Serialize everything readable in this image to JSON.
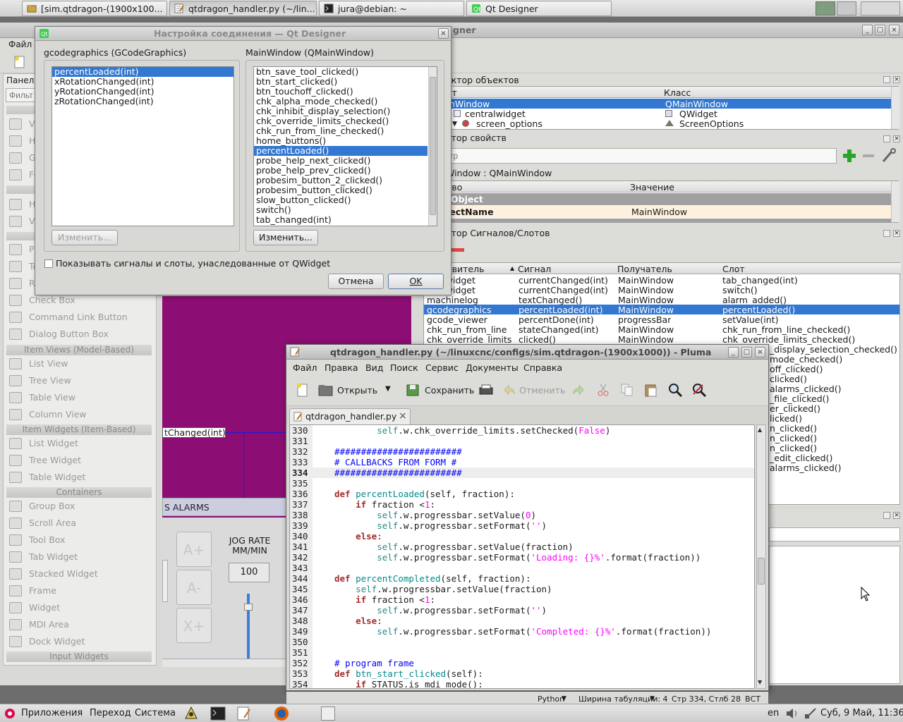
{
  "taskbar_top": {
    "tasks": [
      {
        "label": "[sim.qtdragon-(1900x100...",
        "icon": "folder-icon"
      },
      {
        "label": "qtdragon_handler.py (~/lin...",
        "icon": "text-editor-icon"
      },
      {
        "label": "jura@debian: ~",
        "icon": "terminal-icon"
      },
      {
        "label": "Qt Designer",
        "icon": "qt-icon"
      }
    ]
  },
  "designer": {
    "title_fragment": "gner",
    "menu_file": "Файл",
    "panel_label": "Панел",
    "filter_placeholder": "Фильт",
    "widget_box": {
      "items_top": [
        "Ve",
        "Ho",
        "Gr",
        "Fo",
        "Ho",
        "Ve",
        "Pu",
        "To",
        "Ra"
      ],
      "categories": {
        "item_views": "Item Views (Model-Based)",
        "item_widgets": "Item Widgets (Item-Based)",
        "containers": "Containers",
        "input_widgets": "Input Widgets"
      },
      "buttons": [
        "Check Box",
        "Command Link Button",
        "Dialog Button Box"
      ],
      "views": [
        "List View",
        "Tree View",
        "Table View",
        "Column View"
      ],
      "item_widgets": [
        "List Widget",
        "Tree Widget",
        "Table Widget"
      ],
      "containers": [
        "Group Box",
        "Scroll Area",
        "Tool Box",
        "Tab Widget",
        "Stacked Widget",
        "Frame",
        "Widget",
        "MDI Area",
        "Dock Widget"
      ]
    },
    "form": {
      "connection_label": "tChanged(int)",
      "alarms_tab": "S ALARMS",
      "jog_rate_label": "JOG RATE\nMM/MIN",
      "jog_rate_value": "100",
      "jog_btn_plus": "A+",
      "jog_btn_minus": "A-",
      "jog_btn_x": "X+"
    },
    "object_inspector": {
      "title": "ектор объектов",
      "col_object": "кт",
      "col_class": "Класс",
      "rows": [
        {
          "object": "nWindow",
          "class": "QMainWindow",
          "selected": true
        },
        {
          "object": "centralwidget",
          "class": "QWidget",
          "selected": false
        },
        {
          "object": "screen_options",
          "class": "ScreenOptions",
          "selected": false
        }
      ]
    },
    "property_editor": {
      "title": "ктор свойств",
      "filter_placeholder": "тр",
      "context": "Window : QMainWindow",
      "col_property": "тво",
      "col_value": "Значение",
      "section": "Object",
      "prop_name": "jectName",
      "prop_value": "MainWindow"
    },
    "signal_slot_editor": {
      "title": "ктор Сигналов/Слотов",
      "col_sender": "авитель",
      "col_signal": "Сигнал",
      "col_receiver": "Получатель",
      "col_slot": "Слот",
      "rows": [
        {
          "sender": "tab_widget",
          "signal": "currentChanged(int)",
          "receiver": "MainWindow",
          "slot": "tab_changed(int)",
          "selected": false
        },
        {
          "sender": "tab_widget",
          "signal": "currentChanged(int)",
          "receiver": "MainWindow",
          "slot": "switch()",
          "selected": false
        },
        {
          "sender": "machinelog",
          "signal": "textChanged()",
          "receiver": "MainWindow",
          "slot": "alarm_added()",
          "selected": false
        },
        {
          "sender": "gcodegraphics",
          "signal": "percentLoaded(int)",
          "receiver": "MainWindow",
          "slot": "percentLoaded()",
          "selected": true
        },
        {
          "sender": "gcode_viewer",
          "signal": "percentDone(int)",
          "receiver": "progressBar",
          "slot": "setValue(int)",
          "selected": false
        },
        {
          "sender": "chk_run_from_line",
          "signal": "stateChanged(int)",
          "receiver": "MainWindow",
          "slot": "chk_run_from_line_checked()",
          "selected": false
        },
        {
          "sender": "chk_override_limits",
          "signal": "clicked()",
          "receiver": "MainWindow",
          "slot": "chk_override_limits_checked()",
          "selected": false
        }
      ],
      "more_slots": [
        "_display_selection_checked()",
        "mode_checked()",
        "off_clicked()",
        "clicked()",
        "alarms_clicked()",
        "_file_clicked()",
        "er_clicked()",
        "licked()",
        "n_clicked()",
        "n_clicked()",
        "n_clicked()",
        "_edit_clicked()",
        "alarms_clicked()"
      ]
    }
  },
  "conn_dialog": {
    "title": "Настройка соединения — Qt Designer",
    "left_group": "gcodegraphics (GCodeGraphics)",
    "right_group": "MainWindow (QMainWindow)",
    "signals": [
      "percentLoaded(int)",
      "xRotationChanged(int)",
      "yRotationChanged(int)",
      "zRotationChanged(int)"
    ],
    "signals_selected": 0,
    "slots": [
      "btn_save_tool_clicked()",
      "btn_start_clicked()",
      "btn_touchoff_clicked()",
      "chk_alpha_mode_checked()",
      "chk_inhibit_display_selection()",
      "chk_override_limits_checked()",
      "chk_run_from_line_checked()",
      "home_buttons()",
      "percentLoaded()",
      "probe_help_next_clicked()",
      "probe_help_prev_clicked()",
      "probesim_button_2_clicked()",
      "probesim_button_clicked()",
      "slow_button_clicked()",
      "switch()",
      "tab_changed(int)"
    ],
    "slots_selected": 8,
    "edit_left": "Изменить...",
    "edit_right": "Изменить...",
    "show_inherited": "Показывать сигналы и слоты, унаследованные от QWidget",
    "cancel": "Отмена",
    "ok": "OK"
  },
  "pluma": {
    "title": "qtdragon_handler.py (~/linuxcnc/configs/sim.qtdragon-(1900x1000)) - Pluma",
    "menu": [
      "Файл",
      "Правка",
      "Вид",
      "Поиск",
      "Сервис",
      "Документы",
      "Справка"
    ],
    "toolbar": {
      "open": "Открыть",
      "save": "Сохранить",
      "undo": "Отменить"
    },
    "tab_label": "qtdragon_handler.py",
    "current_line": 334,
    "lines": [
      {
        "n": "330",
        "html": "        <span class=\"slf\">self</span>.w.chk_override_limits.setChecked(<span class=\"cst\">False</span>)"
      },
      {
        "n": "331",
        "html": ""
      },
      {
        "n": "332",
        "html": "<span class=\"cm\">########################</span>"
      },
      {
        "n": "333",
        "html": "<span class=\"cm\"># CALLBACKS FROM FORM #</span>"
      },
      {
        "n": "334",
        "html": "<span class=\"cm\">########################</span>"
      },
      {
        "n": "335",
        "html": ""
      },
      {
        "n": "336",
        "html": "<span class=\"kw\">def</span> <span class=\"fn\">percentLoaded</span>(self, fraction):"
      },
      {
        "n": "337",
        "html": "    <span class=\"kw\">if</span> fraction &lt;<span class=\"num\">1</span>:"
      },
      {
        "n": "338",
        "html": "        <span class=\"slf\">self</span>.w.progressbar.setValue(<span class=\"num\">0</span>)"
      },
      {
        "n": "339",
        "html": "        <span class=\"slf\">self</span>.w.progressbar.setFormat(<span class=\"str\">''</span>)"
      },
      {
        "n": "340",
        "html": "    <span class=\"kw\">else</span>:"
      },
      {
        "n": "341",
        "html": "        <span class=\"slf\">self</span>.w.progressbar.setValue(fraction)"
      },
      {
        "n": "342",
        "html": "        <span class=\"slf\">self</span>.w.progressbar.setFormat(<span class=\"str\">'Loading: {}%'</span>.format(fraction))"
      },
      {
        "n": "343",
        "html": ""
      },
      {
        "n": "344",
        "html": "<span class=\"kw\">def</span> <span class=\"fn\">percentCompleted</span>(self, fraction):"
      },
      {
        "n": "345",
        "html": "    <span class=\"slf\">self</span>.w.progressbar.setValue(fraction)"
      },
      {
        "n": "346",
        "html": "    <span class=\"kw\">if</span> fraction &lt;<span class=\"num\">1</span>:"
      },
      {
        "n": "347",
        "html": "        <span class=\"slf\">self</span>.w.progressbar.setFormat(<span class=\"str\">''</span>)"
      },
      {
        "n": "348",
        "html": "    <span class=\"kw\">else</span>:"
      },
      {
        "n": "349",
        "html": "        <span class=\"slf\">self</span>.w.progressbar.setFormat(<span class=\"str\">'Completed: {}%'</span>.format(fraction))"
      },
      {
        "n": "350",
        "html": ""
      },
      {
        "n": "351",
        "html": ""
      },
      {
        "n": "352",
        "html": "<span class=\"cm\"># program frame</span>"
      },
      {
        "n": "353",
        "html": "<span class=\"kw\">def</span> <span class=\"fn\">btn_start_clicked</span>(self):"
      },
      {
        "n": "354",
        "html": "    <span class=\"kw\">if</span> STATUS.is_mdi_mode():"
      }
    ],
    "status": {
      "language": "Python",
      "tab_width": "Ширина табуляции:  4",
      "position": "Стр 334, Стлб 28",
      "mode": "ВСТ"
    }
  },
  "taskbar_bottom": {
    "apps": "Приложения",
    "places": "Переход",
    "system": "Система",
    "lang": "en",
    "clock": "Суб,  9 Май, 11:36"
  },
  "colors": {
    "selection": "#3277d1",
    "form_bg": "#8c0d73",
    "accent_green": "#2aa52a"
  }
}
